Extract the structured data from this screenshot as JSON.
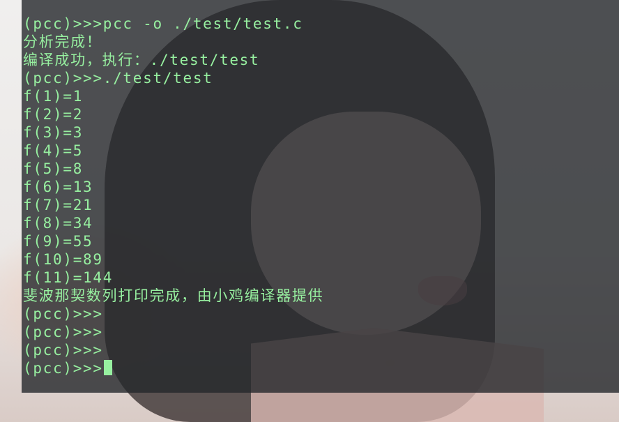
{
  "terminal": {
    "lines": [
      "(pcc)>>>pcc -o ./test/test.c",
      "分析完成！",
      "编译成功，执行：./test/test",
      "(pcc)>>>./test/test",
      "f(1)=1",
      "f(2)=2",
      "f(3)=3",
      "f(4)=5",
      "f(5)=8",
      "f(6)=13",
      "f(7)=21",
      "f(8)=34",
      "f(9)=55",
      "f(10)=89",
      "f(11)=144",
      "斐波那契数列打印完成，由小鸡编译器提供",
      "(pcc)>>>",
      "(pcc)>>>",
      "(pcc)>>>"
    ],
    "prompt": "(pcc)>>>"
  },
  "colors": {
    "terminal_bg": "#24272a",
    "text": "#97f0a0",
    "cursor": "#97f0a0"
  }
}
